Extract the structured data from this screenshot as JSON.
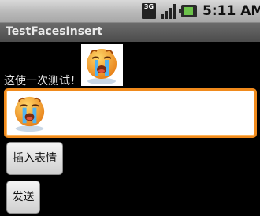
{
  "status_bar": {
    "network": "3G",
    "time": "5:11 AM",
    "icons": [
      "3g-icon",
      "signal-icon",
      "battery-icon"
    ]
  },
  "app": {
    "title": "TestFacesInsert"
  },
  "message": {
    "text": "这使一次测试！",
    "emoji_icon": "crying-face-emoji"
  },
  "edit_field": {
    "emoji_icon": "crying-face-emoji"
  },
  "buttons": {
    "insert_emoji": "插入表情",
    "send": "发送"
  },
  "colors": {
    "background": "#000000",
    "focus_border": "#f08a1c"
  }
}
